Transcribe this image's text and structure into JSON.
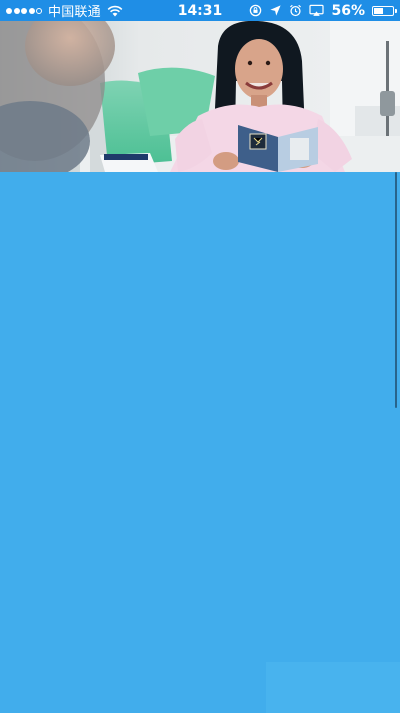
{
  "status_bar": {
    "carrier": "中国联通",
    "time": "14:31",
    "battery_percent": "56%",
    "battery_level": 0.56,
    "signal_bars_filled": 4,
    "signal_bars_total": 5,
    "icons": [
      "signal-dots-icon",
      "wifi-icon",
      "screen-lock-icon",
      "location-arrow-icon",
      "alarm-icon",
      "airplay-icon",
      "battery-icon"
    ]
  },
  "banner": {
    "image": "banner-photo-woman-reading-passport"
  },
  "colors": {
    "status_bar_bg": "#1f8ee6",
    "page_bg": "#41adec",
    "status_text": "#ffffff"
  }
}
